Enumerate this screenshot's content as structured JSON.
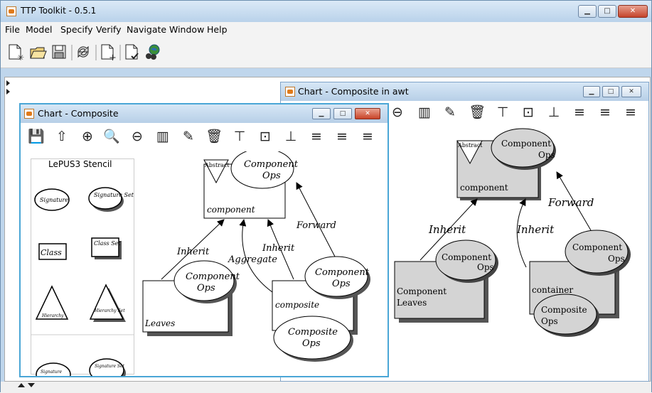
{
  "app": {
    "title": "TTP Toolkit - 0.5.1"
  },
  "window_controls": {
    "minimize": "▁",
    "maximize": "□",
    "close": "✕"
  },
  "menu": [
    "File",
    "Model",
    "Specify",
    "Verify",
    "Navigate",
    "Window",
    "Help"
  ],
  "toolbar_icons": [
    "new-file-sparkle-icon",
    "open-folder-icon",
    "save-disk-icon",
    "refresh-arrows-icon",
    "new-document-plus-icon",
    "document-check-icon",
    "globe-binoculars-icon"
  ],
  "chart_awt": {
    "title": "Chart - Composite in awt",
    "tools": [
      "zoom-out-icon",
      "ruler-columns-icon",
      "edit-pencil-icon",
      "trash-icon",
      "align-top-icon",
      "align-middle-icon",
      "align-bottom-icon",
      "align-left-icon",
      "align-center-icon",
      "align-right-icon"
    ],
    "tool_glyphs": [
      "⊖",
      "▥",
      "✎",
      "🗑",
      "⊤",
      "⊡",
      "⊥",
      "≡",
      "≡",
      "≡"
    ],
    "diagram": {
      "abstract_label": "Abstract",
      "component_class": "component",
      "component_ops": [
        "Component",
        "Ops"
      ],
      "leaves_class": [
        "Component",
        "Leaves"
      ],
      "leaves_ops": [
        "Component",
        "Ops"
      ],
      "container_class": "container",
      "container_ops": [
        "Component",
        "Ops"
      ],
      "composite_ops": [
        "Composite",
        "Ops"
      ],
      "edges": [
        "Inherit",
        "Inherit",
        "Forward"
      ]
    }
  },
  "chart_composite": {
    "title": "Chart - Composite",
    "tools": [
      "save-icon",
      "upload-icon",
      "zoom-in-icon",
      "zoom-icon",
      "zoom-out-icon",
      "ruler-columns-icon",
      "edit-pencil-icon",
      "trash-icon",
      "align-top-icon",
      "align-middle-icon",
      "align-bottom-icon",
      "align-left-icon",
      "align-center-icon",
      "align-right-icon"
    ],
    "tool_glyphs": [
      "💾",
      "⇧",
      "⊕",
      "🔍",
      "⊖",
      "▥",
      "✎",
      "🗑",
      "⊤",
      "⊡",
      "⊥",
      "≡",
      "≡",
      "≡"
    ],
    "stencil": {
      "title": "LePUS3 Stencil",
      "items": [
        "Signature",
        "Signature Set",
        "Class",
        "Class Set",
        "Hierarchy",
        "Hierarchy Set",
        "Signature",
        "Signature Set"
      ]
    },
    "diagram": {
      "abstract_label": "Abstract",
      "component_class": "component",
      "component_ops": [
        "Component",
        "Ops"
      ],
      "leaves_class": "Leaves",
      "leaves_ops": [
        "Component",
        "Ops"
      ],
      "composite_class": "composite",
      "composite_component_ops": [
        "Component",
        "Ops"
      ],
      "composite_ops": [
        "Composite",
        "Ops"
      ],
      "edges": [
        "Inherit",
        "Aggregate",
        "Inherit",
        "Forward"
      ]
    }
  }
}
